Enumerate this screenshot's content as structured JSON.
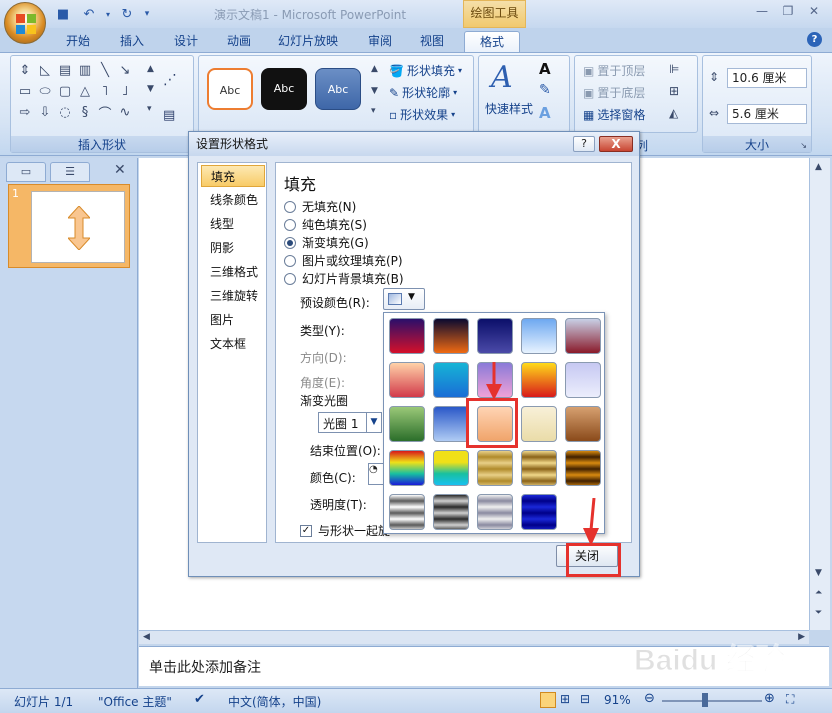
{
  "window": {
    "title": "演示文稿1 - Microsoft PowerPoint",
    "context_tab": "绘图工具"
  },
  "tabs": [
    {
      "label": "开始"
    },
    {
      "label": "插入"
    },
    {
      "label": "设计"
    },
    {
      "label": "动画"
    },
    {
      "label": "幻灯片放映"
    },
    {
      "label": "审阅"
    },
    {
      "label": "视图"
    },
    {
      "label": "格式"
    }
  ],
  "ribbon": {
    "insert_shapes_label": "插入形状",
    "shape_style_sample": "Abc",
    "shape_fill": "形状填充",
    "shape_outline": "形状轮廓",
    "shape_effects": "形状效果",
    "quick_styles": "快速样式",
    "bring_front": "置于顶层",
    "send_back": "置于底层",
    "selection_pane": "选择窗格",
    "arrange_label_partial": "列",
    "size_label": "大小",
    "height_value": "10.6 厘米",
    "width_value": "5.6 厘米"
  },
  "left_panel": {
    "slide_number": "1"
  },
  "notes_placeholder": "单击此处添加备注",
  "status": {
    "slide": "幻灯片 1/1",
    "theme": "\"Office 主题\"",
    "language": "中文(简体，中国)",
    "zoom": "91%"
  },
  "dialog": {
    "title": "设置形状格式",
    "help": "?",
    "close_x": "X",
    "nav": [
      "填充",
      "线条颜色",
      "线型",
      "阴影",
      "三维格式",
      "三维旋转",
      "图片",
      "文本框"
    ],
    "heading": "填充",
    "fill_options": [
      {
        "label": "无填充(N)",
        "checked": false
      },
      {
        "label": "纯色填充(S)",
        "checked": false
      },
      {
        "label": "渐变填充(G)",
        "checked": true
      },
      {
        "label": "图片或纹理填充(P)",
        "checked": false
      },
      {
        "label": "幻灯片背景填充(B)",
        "checked": false
      }
    ],
    "preset_colors_label": "预设颜色(R):",
    "type_label": "类型(Y):",
    "direction_label": "方向(D):",
    "angle_label": "角度(E):",
    "gradient_stops_label": "渐变光圈",
    "stop_value": "光圈 1",
    "end_position_label": "结束位置(O):",
    "color_label": "颜色(C):",
    "transparency_label": "透明度(T):",
    "rotate_with_shape": "与形状一起旋",
    "close_button": "关闭"
  },
  "gallery_swatches": [
    [
      "#2a0f6b|#d4102a",
      "#0b0a30|#f06a12",
      "#0b0f6a|#4b4aa8",
      "#6ea8f0|#e8f3ff",
      "#c8d0e6|#8a1a2a"
    ],
    [
      "#ffd2a8|#d23a4a",
      "#16b4d6|#1a6dd6",
      "#8a7ad8|#f0a2d8",
      "#ffdb1a|#d81a1a",
      "#c6c8f2|#eceefc"
    ],
    [
      "#9ac878|#2b6e2a",
      "#2a58c8|#b0ccf4",
      "#ffd4b4|#f0a46a",
      "#f8f0d8|#eadca8",
      "#d6a070|#8a4a1a"
    ],
    [
      "#d8181a|#1a1ad8",
      "#f0e018|#18c0f0",
      "#e8d088|#b08a2a",
      "#f0d88a|#8a6218",
      "#d88a10|#402000"
    ],
    [
      "#ffffff|#5a5a5a",
      "#2a2a2a|#d0d0d0",
      "#f0f0f0|#8a8aa0",
      "#1a28d8|#000088",
      ""
    ]
  ],
  "watermark": "Baidu 经验"
}
